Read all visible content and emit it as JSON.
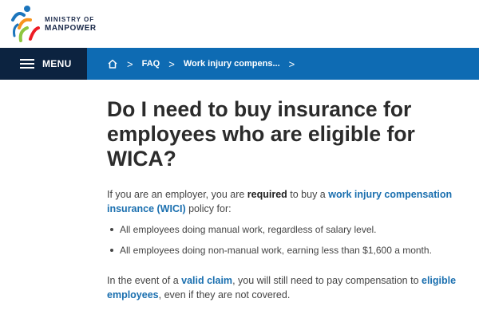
{
  "logo": {
    "line1": "MINISTRY OF",
    "line2": "MANPOWER"
  },
  "nav": {
    "menu_label": "MENU",
    "breadcrumb": {
      "home_icon": "home-icon",
      "separator": ">",
      "items": [
        "FAQ",
        "Work injury compens..."
      ]
    }
  },
  "article": {
    "title": "Do I need to buy insurance for employees who are eligible for WICA?",
    "p1": {
      "part1": "If you are an employer, you are ",
      "required": "required",
      "part2": " to buy a ",
      "link": "work injury compensation insurance (WICI)",
      "part3": " policy for:"
    },
    "bullets": [
      "All employees doing manual work, regardless of salary level.",
      "All employees doing non-manual work, earning less than $1,600 a month."
    ],
    "p2": {
      "part1": "In the event of a ",
      "link1": "valid claim",
      "part2": ", you will still need to pay compensation to ",
      "link2": "eligible employees",
      "part3": ", even if they are not covered."
    }
  },
  "colors": {
    "nav_blue": "#0e6bb3",
    "menu_dark": "#0c2340",
    "link": "#1a6faf"
  }
}
